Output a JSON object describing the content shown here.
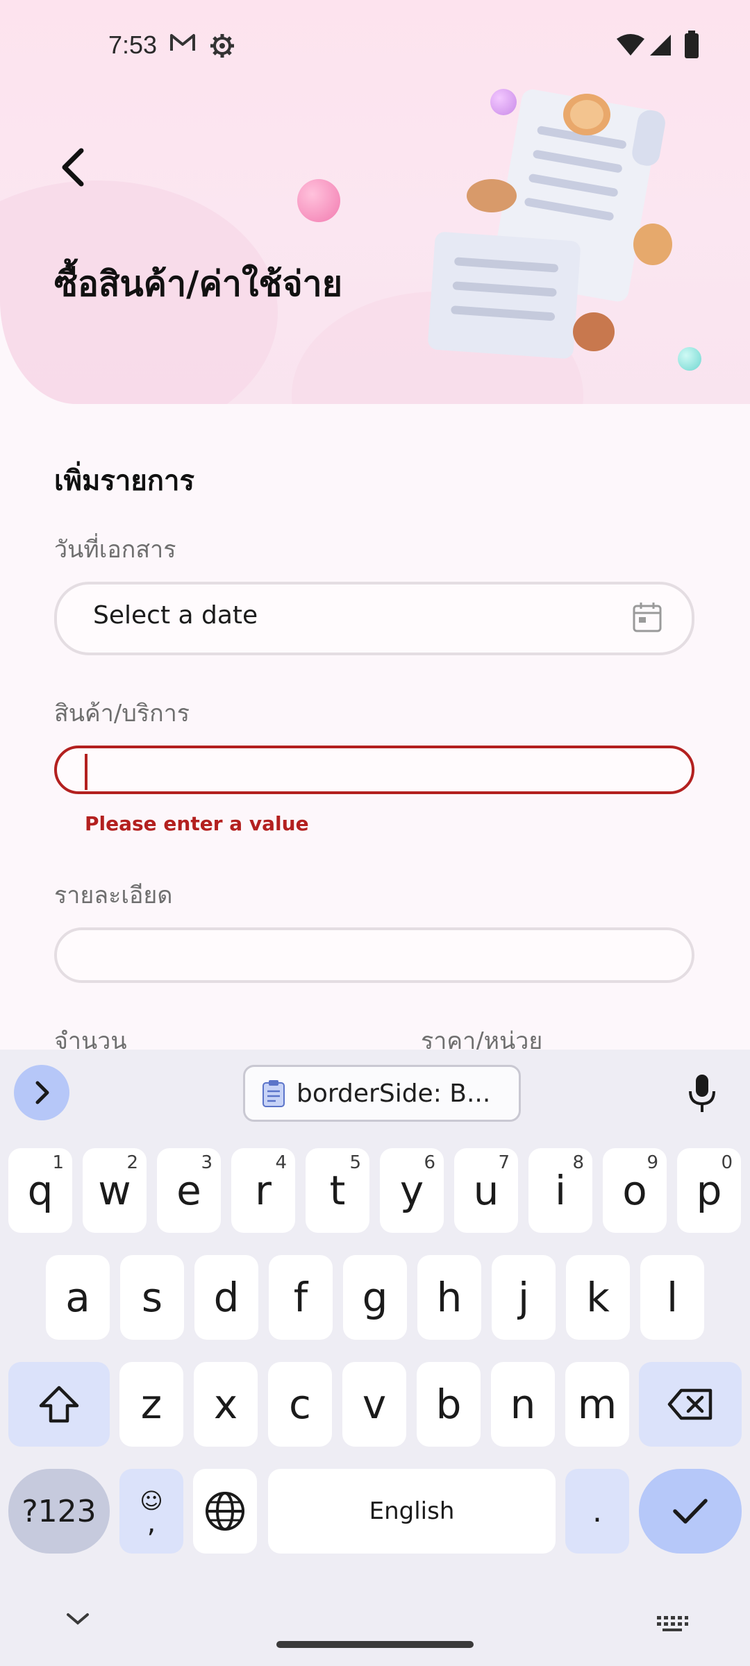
{
  "status_bar": {
    "time": "7:53"
  },
  "header": {
    "title": "ซื้อสินค้า/ค่าใช้จ่าย"
  },
  "form": {
    "section_title": "เพิ่มรายการ",
    "doc_date_label": "วันที่เอกสาร",
    "doc_date_placeholder": "Select a date",
    "product_label": "สินค้า/บริการ",
    "product_value": "",
    "product_error": "Please enter a value",
    "detail_label": "รายละเอียด",
    "detail_value": "",
    "quantity_label": "จำนวน",
    "unit_price_label": "ราคา/หน่วย"
  },
  "keyboard": {
    "clipboard_text": "borderSide: B...",
    "row1": [
      {
        "key": "q",
        "hint": "1"
      },
      {
        "key": "w",
        "hint": "2"
      },
      {
        "key": "e",
        "hint": "3"
      },
      {
        "key": "r",
        "hint": "4"
      },
      {
        "key": "t",
        "hint": "5"
      },
      {
        "key": "y",
        "hint": "6"
      },
      {
        "key": "u",
        "hint": "7"
      },
      {
        "key": "i",
        "hint": "8"
      },
      {
        "key": "o",
        "hint": "9"
      },
      {
        "key": "p",
        "hint": "0"
      }
    ],
    "row2": [
      "a",
      "s",
      "d",
      "f",
      "g",
      "h",
      "j",
      "k",
      "l"
    ],
    "row3": [
      "z",
      "x",
      "c",
      "v",
      "b",
      "n",
      "m"
    ],
    "symbols_label": "?123",
    "emoji_comma_top": "☺",
    "emoji_comma_bottom": ",",
    "space_label": "English",
    "period_label": "."
  },
  "colors": {
    "accent": "#b6c8f9",
    "error": "#b3201f",
    "modifier_key": "#dbe2fa"
  }
}
